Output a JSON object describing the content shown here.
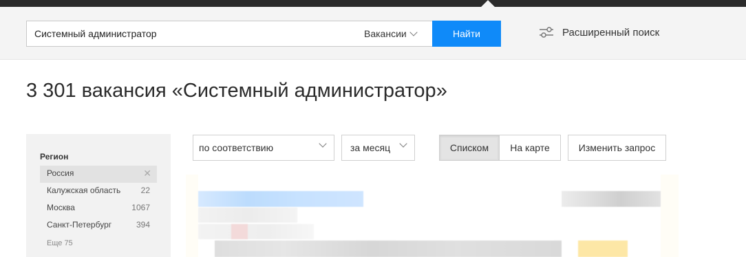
{
  "search": {
    "query": "Системный администратор",
    "type_label": "Вакансии",
    "submit_label": "Найти",
    "advanced_label": "Расширенный поиск"
  },
  "heading": "3 301 вакансия «Системный администратор»",
  "sidebar": {
    "title": "Регион",
    "items": [
      {
        "label": "Россия",
        "count": ""
      },
      {
        "label": "Калужская область",
        "count": "22"
      },
      {
        "label": "Москва",
        "count": "1067"
      },
      {
        "label": "Санкт-Петербург",
        "count": "394"
      }
    ],
    "more_label": "Еще 75"
  },
  "toolbar": {
    "sort_value": "по соответствию",
    "period_value": "за месяц",
    "view_list_label": "Списком",
    "view_map_label": "На карте",
    "change_query_label": "Изменить запрос"
  },
  "colors": {
    "accent": "#0f8af9",
    "topbar": "#2b2b2b",
    "sidebar_bg": "#f2f2f2"
  },
  "icons": {
    "type_dropdown": "chevron-down-icon",
    "advanced": "sliders-icon",
    "remove_filter": "close-icon"
  }
}
